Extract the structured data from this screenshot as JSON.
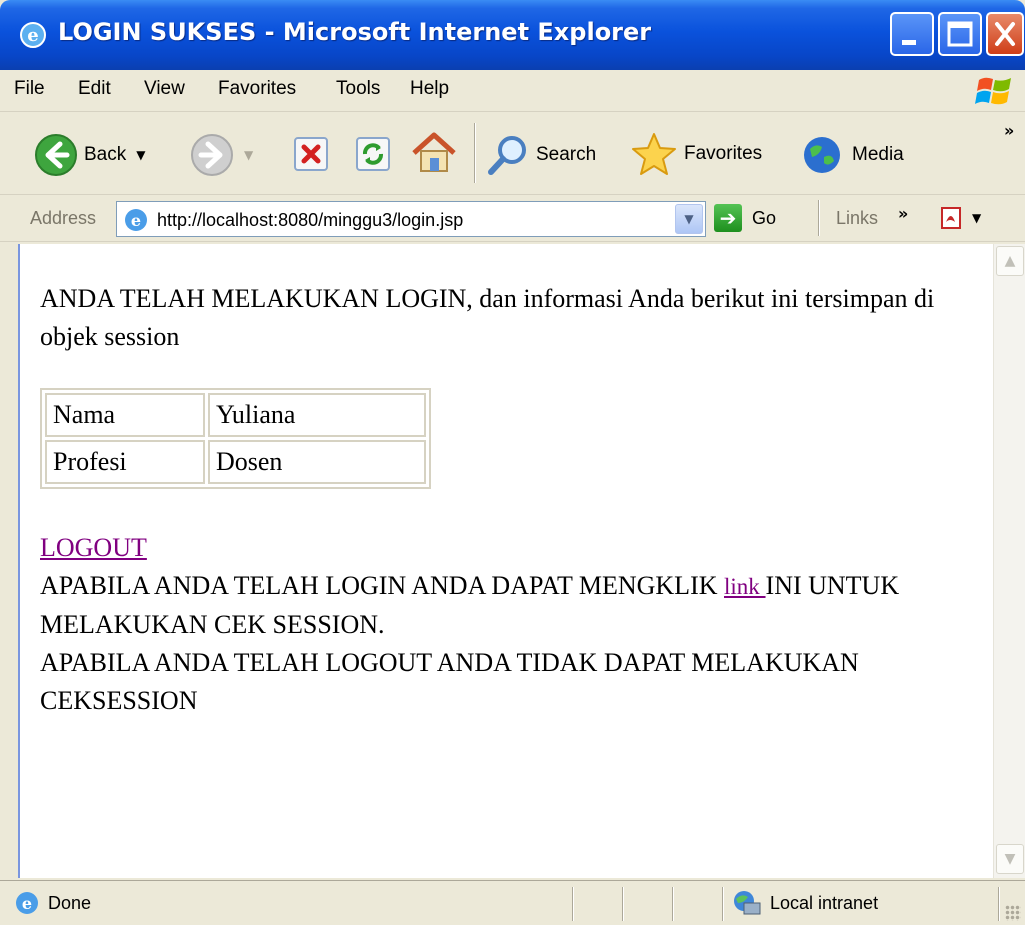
{
  "window": {
    "title": "LOGIN SUKSES - Microsoft Internet Explorer"
  },
  "menu": {
    "items": [
      "File",
      "Edit",
      "View",
      "Favorites",
      "Tools",
      "Help"
    ]
  },
  "toolbar": {
    "back_label": "Back",
    "search_label": "Search",
    "favorites_label": "Favorites",
    "media_label": "Media",
    "more_chevron": "»"
  },
  "address": {
    "label": "Address",
    "url": "http://localhost:8080/minggu3/login.jsp",
    "go_label": "Go",
    "links_label": "Links",
    "links_chevron": "»"
  },
  "page": {
    "intro": "ANDA TELAH MELAKUKAN LOGIN, dan informasi Anda berikut ini tersimpan di objek session",
    "table": [
      {
        "key": "Nama",
        "value": "Yuliana"
      },
      {
        "key": "Profesi",
        "value": "Dosen"
      }
    ],
    "logout_link": "LOGOUT",
    "para2_before": "APABILA ANDA TELAH LOGIN ANDA DAPAT MENGKLIK ",
    "para2_link": "link ",
    "para2_after": "INI UNTUK MELAKUKAN CEK SESSION.",
    "para3": "APABILA ANDA TELAH LOGOUT ANDA TIDAK DAPAT MELAKUKAN CEKSESSION"
  },
  "status": {
    "text": "Done",
    "zone": "Local intranet"
  },
  "icons": {
    "title": "ie-icon",
    "back": "back-arrow-icon",
    "forward": "forward-arrow-icon",
    "stop": "stop-icon",
    "refresh": "refresh-icon",
    "home": "home-icon",
    "search": "search-icon",
    "favorites": "favorites-star-icon",
    "media": "media-globe-icon"
  }
}
